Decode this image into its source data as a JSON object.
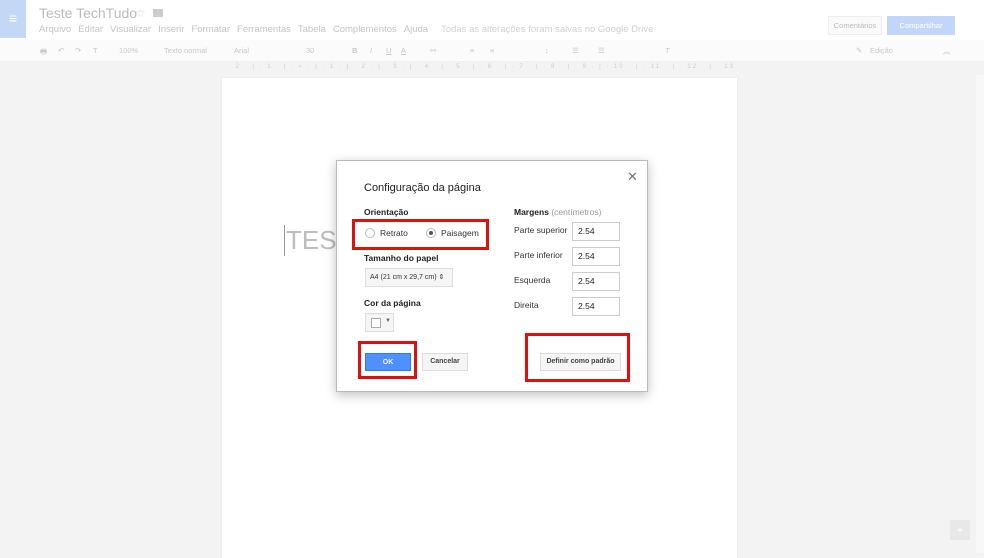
{
  "app": {
    "title": "Teste TechTudo",
    "menu": [
      "Arquivo",
      "Editar",
      "Visualizar",
      "Inserir",
      "Formatar",
      "Ferramentas",
      "Tabela",
      "Complementos",
      "Ajuda"
    ],
    "saved_status": "Todas as alterações foram salvas no Google Drive",
    "comments_label": "Comentários",
    "share_label": "Compartilhar"
  },
  "toolbar": {
    "zoom": "100%",
    "style": "Texto normal",
    "font": "Arial",
    "size": "30",
    "mode": "Edição"
  },
  "ruler": "· 2 · | · 1 · | · ▿ · | · 1 · | · 2 · | · 3 · | · 4 · | · 5 · | · 6 · | · 7 · | · 8 · | · 9 · | · 10 · | · 11 · | · 12 · | · 13 · | · 14 · | · 15 · | · 16 · | · 17 · | · 18",
  "document": {
    "text": "TES"
  },
  "dialog": {
    "title": "Configuração da página",
    "orientation_label": "Orientação",
    "portrait": "Retrato",
    "landscape": "Paisagem",
    "selected": "Paisagem",
    "paper_size_label": "Tamanho do papel",
    "paper_size": "A4 (21 cm x 29,7 cm)",
    "page_color_label": "Cor da página",
    "page_color": "#ffffff",
    "margins_label": "Margens",
    "margins_unit": "(centímetros)",
    "margins": [
      {
        "label": "Parte superior",
        "value": "2.54"
      },
      {
        "label": "Parte inferior",
        "value": "2.54"
      },
      {
        "label": "Esquerda",
        "value": "2.54"
      },
      {
        "label": "Direita",
        "value": "2.54"
      }
    ],
    "ok": "OK",
    "cancel": "Cancelar",
    "set_default": "Definir como padrão"
  },
  "colors": {
    "highlight": "#e01010",
    "primary": "#4d90fe"
  }
}
